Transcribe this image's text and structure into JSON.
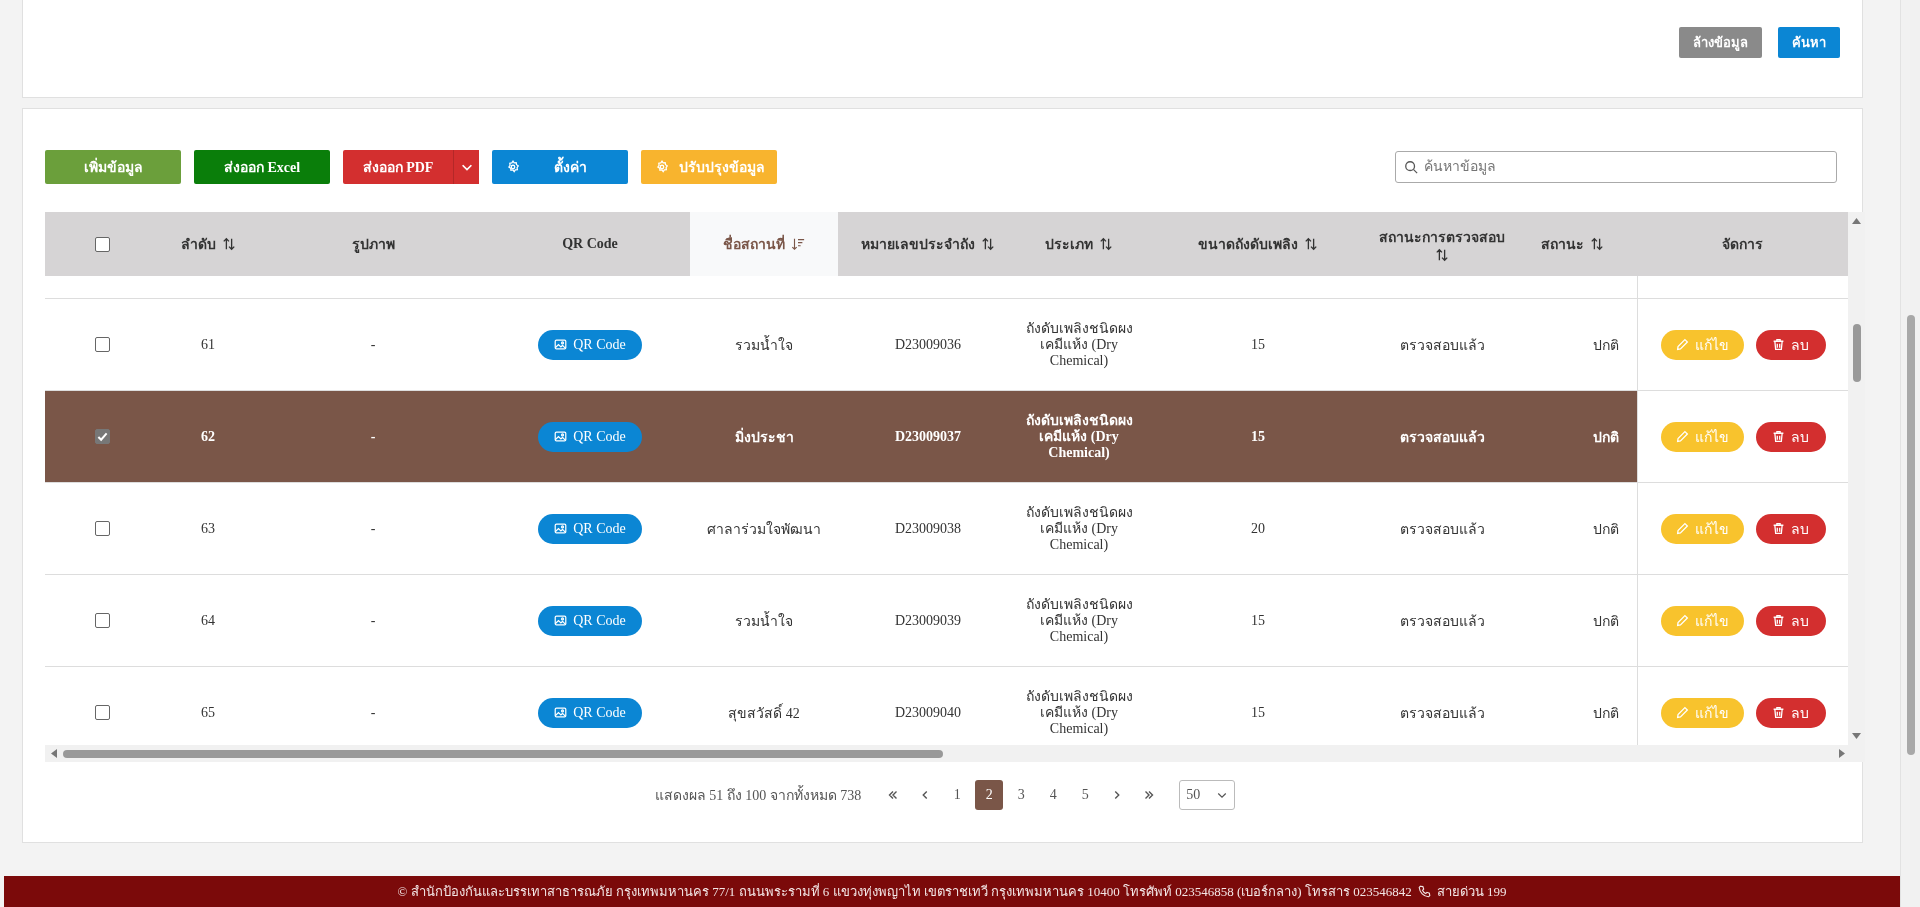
{
  "filter_actions": [
    {
      "label": "ล้างข้อมูล",
      "kind": "clear"
    },
    {
      "label": "ค้นหา",
      "kind": "search"
    }
  ],
  "toolbar": [
    {
      "label": "เพิ่มข้อมูล",
      "kind": "add"
    },
    {
      "label": "ส่งออก Excel",
      "kind": "excel"
    },
    {
      "label": "ส่งออก PDF",
      "kind": "pdf"
    },
    {
      "label": "ตั้งค่า",
      "kind": "settings"
    },
    {
      "label": "ปรับปรุงข้อมูล",
      "kind": "update"
    }
  ],
  "search": {
    "placeholder": "ค้นหาข้อมูล"
  },
  "table": {
    "select_all": {
      "checked": false
    },
    "columns": [
      {
        "label": "ลำดับ",
        "sortable": true,
        "sorted": false
      },
      {
        "label": "รูปภาพ",
        "sortable": false,
        "sorted": false
      },
      {
        "label": "QR Code",
        "sortable": false,
        "sorted": false
      },
      {
        "label": "ชื่อสถานที่",
        "sortable": true,
        "sorted": true
      },
      {
        "label": "หมายเลขประจำถัง",
        "sortable": true,
        "sorted": false
      },
      {
        "label": "ประเภท",
        "sortable": true,
        "sorted": false
      },
      {
        "label": "ขนาดถังดับเพลิง",
        "sortable": true,
        "sorted": false
      },
      {
        "label": "สถานะการตรวจสอบ",
        "sortable": true,
        "sorted": false
      },
      {
        "label": "สถานะ",
        "sortable": true,
        "sorted": false
      },
      {
        "label": "จัดการ",
        "sortable": false,
        "sorted": false
      }
    ],
    "rows": [
      {
        "selected": false,
        "checked": false,
        "index": "61",
        "image": "-",
        "qr_label": "QR Code",
        "place": "รวมน้ำใจ",
        "tank_no": "D23009036",
        "type": "ถังดับเพลิงชนิดผงเคมีแห้ง (Dry Chemical)",
        "size": "15",
        "inspection": "ตรวจสอบแล้ว",
        "status": "ปกติ",
        "edit_label": "แก้ไข",
        "delete_label": "ลบ"
      },
      {
        "selected": true,
        "checked": true,
        "index": "62",
        "image": "-",
        "qr_label": "QR Code",
        "place": "มิ่งประชา",
        "tank_no": "D23009037",
        "type": "ถังดับเพลิงชนิดผงเคมีแห้ง (Dry Chemical)",
        "size": "15",
        "inspection": "ตรวจสอบแล้ว",
        "status": "ปกติ",
        "edit_label": "แก้ไข",
        "delete_label": "ลบ"
      },
      {
        "selected": false,
        "checked": false,
        "index": "63",
        "image": "-",
        "qr_label": "QR Code",
        "place": "ศาลาร่วมใจพัฒนา",
        "tank_no": "D23009038",
        "type": "ถังดับเพลิงชนิดผงเคมีแห้ง (Dry Chemical)",
        "size": "20",
        "inspection": "ตรวจสอบแล้ว",
        "status": "ปกติ",
        "edit_label": "แก้ไข",
        "delete_label": "ลบ"
      },
      {
        "selected": false,
        "checked": false,
        "index": "64",
        "image": "-",
        "qr_label": "QR Code",
        "place": "รวมน้ำใจ",
        "tank_no": "D23009039",
        "type": "ถังดับเพลิงชนิดผงเคมีแห้ง (Dry Chemical)",
        "size": "15",
        "inspection": "ตรวจสอบแล้ว",
        "status": "ปกติ",
        "edit_label": "แก้ไข",
        "delete_label": "ลบ"
      },
      {
        "selected": false,
        "checked": false,
        "index": "65",
        "image": "-",
        "qr_label": "QR Code",
        "place": "สุขสวัสดิ์ 42",
        "tank_no": "D23009040",
        "type": "ถังดับเพลิงชนิดผงเคมีแห้ง (Dry Chemical)",
        "size": "15",
        "inspection": "ตรวจสอบแล้ว",
        "status": "ปกติ",
        "edit_label": "แก้ไข",
        "delete_label": "ลบ"
      }
    ]
  },
  "pagination": {
    "summary": "แสดงผล 51 ถึง 100 จากทั้งหมด 738",
    "pages": [
      {
        "label": "1",
        "selected": false
      },
      {
        "label": "2",
        "selected": true
      },
      {
        "label": "3",
        "selected": false
      },
      {
        "label": "4",
        "selected": false
      },
      {
        "label": "5",
        "selected": false
      }
    ],
    "page_size": "50"
  },
  "footer": {
    "text": "© สำนักป้องกันและบรรเทาสาธารณภัย กรุงเทพมหานคร 77/1 ถนนพระรามที่ 6 แขวงทุ่งพญาไท เขตราชเทวี กรุงเทพมหานคร 10400 โทรศัพท์ 023546858 (เบอร์กลาง) โทรสาร 023546842",
    "hotline": "สายด่วน 199"
  }
}
